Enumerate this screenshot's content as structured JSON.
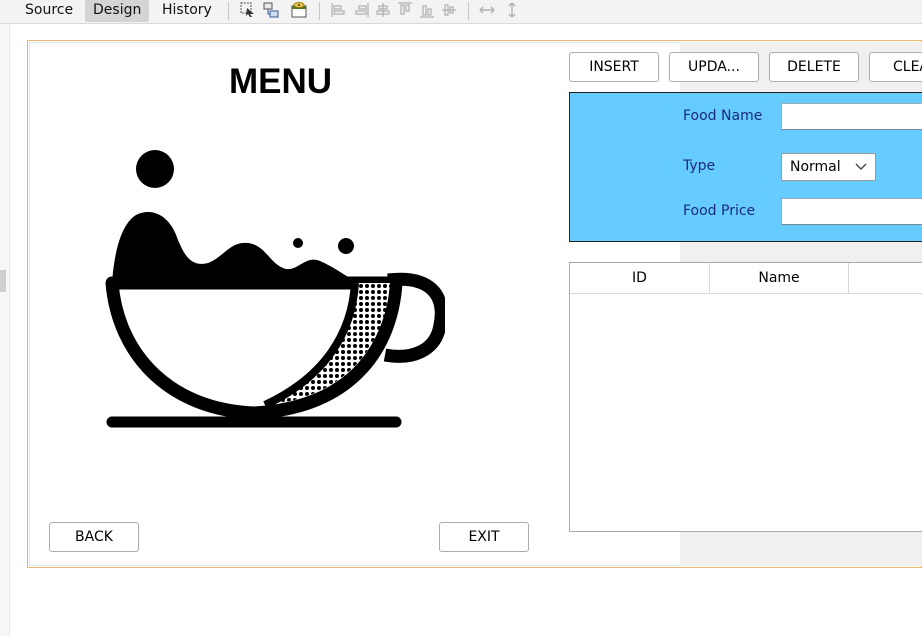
{
  "editor": {
    "tabs": [
      {
        "label": "Source"
      },
      {
        "label": "Design",
        "active": true
      },
      {
        "label": "History"
      }
    ],
    "toolbar_icons": [
      "selection-mode-icon",
      "connection-mode-icon",
      "preview-design-icon",
      "align-left-icon",
      "align-right-icon",
      "center-horizontal-icon",
      "align-top-icon",
      "align-bottom-icon",
      "center-vertical-icon",
      "same-width-icon",
      "same-height-icon"
    ]
  },
  "form": {
    "title": "MENU",
    "image_icon": "coffee-cup-icon",
    "buttons": {
      "insert": "INSERT",
      "update": "UPDA...",
      "delete": "DELETE",
      "clear": "CLEA",
      "back": "BACK",
      "exit": "EXIT"
    },
    "fields": {
      "food_name_label": "Food Name",
      "food_name_value": "",
      "type_label": "Type",
      "type_selected": "Normal",
      "food_price_label": "Food Price",
      "food_price_value": ""
    },
    "table": {
      "columns": [
        "ID",
        "Name"
      ],
      "rows": []
    }
  },
  "colors": {
    "panel_background": "#66ccff",
    "frame_border": "#e7b86a",
    "label_text": "#1a2a7a"
  }
}
